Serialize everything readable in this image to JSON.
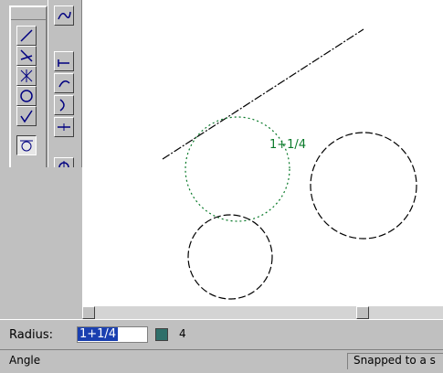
{
  "canvas": {
    "dim_label": "1+1/4",
    "colors": {
      "tangent_circle": "#0a7a2a",
      "dim_text": "#0a7a2a",
      "geometry": "#000000"
    }
  },
  "toolbar_main": {
    "icons": [
      "diagonal-line-icon",
      "crossing-lines-icon",
      "asterisk-icon",
      "circle-icon",
      "check-tangent-icon",
      "tangent-circle-icon"
    ],
    "active": "tangent-circle-icon"
  },
  "toolbar_side": {
    "icons": [
      "sketch-icon",
      "offset-arc-icon",
      "curve-arrow-icon",
      "dimension-icon",
      "trim-icon",
      "snap-icon",
      "pin-icon",
      "help-icon"
    ]
  },
  "radius": {
    "label": "Radius:",
    "value": "1+1/4",
    "aux": "4"
  },
  "status": {
    "left": "Angle",
    "right": "Snapped to a s"
  }
}
